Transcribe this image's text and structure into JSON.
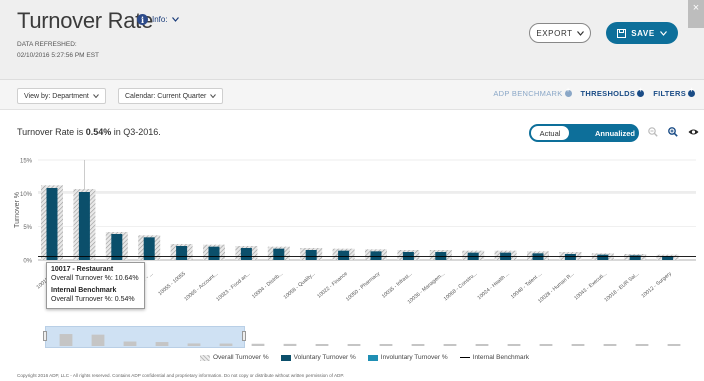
{
  "header": {
    "title": "Turnover Rate",
    "info_label": "Info:",
    "info_icon_glyph": "i",
    "refreshed_label": "DATA REFRESHED:",
    "refreshed_value": "02/10/2016 5:27:56 PM EST",
    "export_label": "EXPORT",
    "save_label": "SAVE",
    "close_glyph": "×"
  },
  "toolbar": {
    "view_by": "View by: Department",
    "calendar": "Calendar: Current Quarter",
    "benchmark_link": "ADP BENCHMARK",
    "thresholds_link": "THRESHOLDS",
    "filters_link": "FILTERS"
  },
  "summary": {
    "prefix": "Turnover Rate is ",
    "value": "0.54%",
    "suffix": " in Q3-2016."
  },
  "toggle": {
    "actual": "Actual",
    "annualized": "Annualized"
  },
  "colors": {
    "voluntary": "#0b4f6b",
    "involuntary": "#1f8fb4",
    "overall_hatch": "#b5b5b5",
    "benchmark": "#000000",
    "accent": "#0d6f9a"
  },
  "tooltip": {
    "dept": "10017 - Restaurant",
    "overall": "Overall Turnover %: 10.64%",
    "bench_title": "Internal Benchmark",
    "bench_value": "Overall Turnover %: 0.54%"
  },
  "legend": {
    "overall": "Overall Turnover %",
    "voluntary": "Voluntary Turnover %",
    "involuntary": "Involuntary Turnover %",
    "benchmark": "Internal Benchmark"
  },
  "copyright": "Copyright 2016 ADP, LLC - All rights reserved. Contains ADP confidential and proprietary information. Do not copy or distribute without written permission of ADP.",
  "chart_data": {
    "type": "bar",
    "ylabel": "Turnover %",
    "ytick_labels": [
      "0%",
      "5%",
      "10%",
      "15%"
    ],
    "ylim": [
      0,
      15
    ],
    "benchmark": 0.54,
    "categories": [
      "10015 - ...",
      "10017 - Restaurant",
      "10056 - Hospit...",
      "10057 - ...",
      "10055 - 10055",
      "10065 - Account...",
      "10023 - Food an...",
      "10004 - Distrib...",
      "10058 - Quality...",
      "10022 - Finance",
      "10050 - Pharmacy",
      "10035 - Infrast...",
      "10036 - Managem...",
      "10068 - Constru...",
      "10024 - Health ...",
      "10048 - Talent ...",
      "10028 - Human R...",
      "10043 - Executi...",
      "10018 - EUR Sal...",
      "10012 - Surgery"
    ],
    "series": [
      {
        "name": "Overall Turnover %",
        "values": [
          11.2,
          10.64,
          4.2,
          3.7,
          2.4,
          2.3,
          2.1,
          2.0,
          1.8,
          1.7,
          1.6,
          1.5,
          1.5,
          1.4,
          1.4,
          1.3,
          1.2,
          1.0,
          0.9,
          0.8
        ]
      },
      {
        "name": "Voluntary Turnover %",
        "values": [
          10.8,
          10.2,
          3.9,
          3.4,
          2.1,
          2.0,
          1.8,
          1.7,
          1.5,
          1.4,
          1.3,
          1.2,
          1.2,
          1.1,
          1.1,
          1.0,
          0.9,
          0.8,
          0.7,
          0.6
        ]
      },
      {
        "name": "Involuntary Turnover %",
        "values": [
          0,
          0,
          0,
          0,
          0,
          0,
          0,
          0,
          0,
          0,
          0,
          0,
          0,
          0,
          0,
          0,
          0,
          0,
          0,
          0
        ]
      }
    ]
  }
}
